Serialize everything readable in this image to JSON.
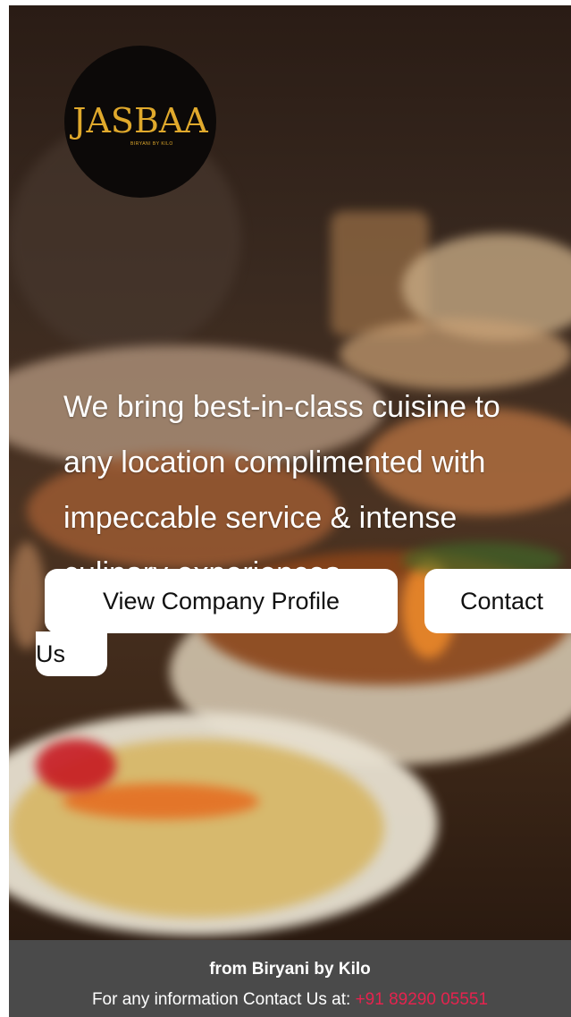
{
  "brand": {
    "logo_text": "JASBAA",
    "logo_sub": "BIRYANI BY KILO"
  },
  "hero": {
    "tagline_lines": [
      "We bring best-in-class cuisine to",
      "any location complimented with",
      "impeccable service & intense",
      "culinary experiences."
    ]
  },
  "buttons": {
    "view_profile": "View Company Profile",
    "contact_part1": "Contact",
    "contact_part2": "Us"
  },
  "footer": {
    "title": "from Biryani by Kilo",
    "info_prefix": "For any information Contact Us at:",
    "phone": "+91 89290 05551"
  },
  "colors": {
    "footer_bg": "#4a4a4a",
    "phone": "#e5234e",
    "logo_gold": "#e0a92c"
  }
}
